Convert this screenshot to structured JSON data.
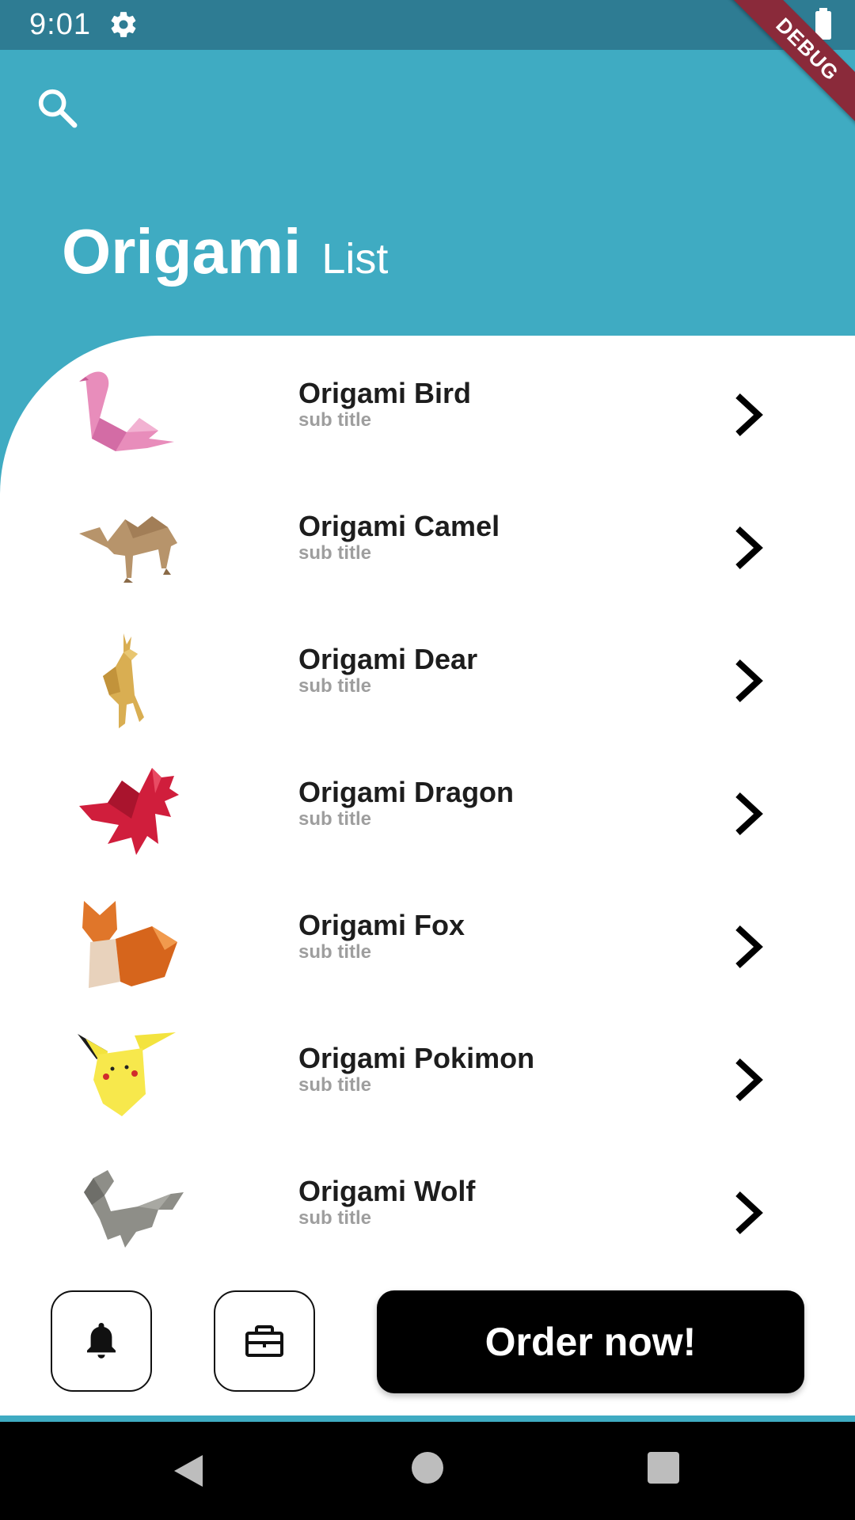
{
  "status_bar": {
    "time": "9:01"
  },
  "debug_banner": "DEBUG",
  "header": {
    "title": "Origami",
    "subtitle": "List"
  },
  "items": [
    {
      "title": "Origami Bird",
      "subtitle": "sub title",
      "icon": "bird"
    },
    {
      "title": "Origami Camel",
      "subtitle": "sub title",
      "icon": "camel"
    },
    {
      "title": "Origami Dear",
      "subtitle": "sub title",
      "icon": "deer"
    },
    {
      "title": "Origami Dragon",
      "subtitle": "sub title",
      "icon": "dragon"
    },
    {
      "title": "Origami Fox",
      "subtitle": "sub title",
      "icon": "fox"
    },
    {
      "title": "Origami Pokimon",
      "subtitle": "sub title",
      "icon": "pokemon"
    },
    {
      "title": "Origami Wolf",
      "subtitle": "sub title",
      "icon": "wolf"
    }
  ],
  "actions": {
    "order_label": "Order now!"
  },
  "colors": {
    "header": "#3FABC2",
    "status_bar": "#2E7C93",
    "debug": "#8A2A3A"
  }
}
